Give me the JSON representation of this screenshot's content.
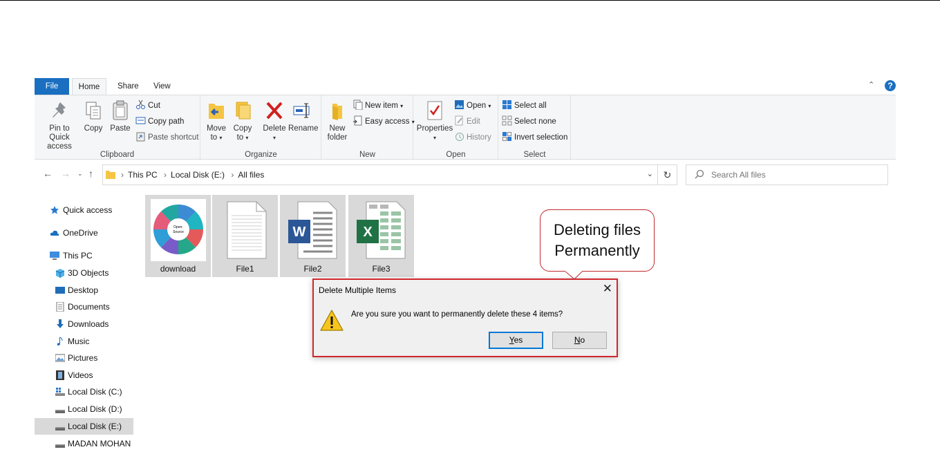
{
  "ribbon": {
    "tabs": {
      "file": "File",
      "home": "Home",
      "share": "Share",
      "view": "View"
    },
    "clipboard": {
      "label": "Clipboard",
      "pin_line1": "Pin to Quick",
      "pin_line2": "access",
      "copy": "Copy",
      "paste": "Paste",
      "cut": "Cut",
      "copy_path": "Copy path",
      "paste_shortcut": "Paste shortcut"
    },
    "organize": {
      "label": "Organize",
      "move_line1": "Move",
      "move_line2": "to",
      "copy_line1": "Copy",
      "copy_line2": "to",
      "delete": "Delete",
      "rename": "Rename"
    },
    "new": {
      "label": "New",
      "folder_line1": "New",
      "folder_line2": "folder",
      "new_item": "New item",
      "easy_access": "Easy access"
    },
    "open": {
      "label": "Open",
      "properties": "Properties",
      "open": "Open",
      "edit": "Edit",
      "history": "History"
    },
    "select": {
      "label": "Select",
      "select_all": "Select all",
      "select_none": "Select none",
      "invert": "Invert selection"
    }
  },
  "address": {
    "crumbs": [
      "This PC",
      "Local Disk (E:)",
      "All files"
    ]
  },
  "search": {
    "placeholder": "Search All files"
  },
  "nav": {
    "items": [
      {
        "label": "Quick access"
      },
      {
        "label": "OneDrive"
      },
      {
        "label": "This PC"
      },
      {
        "label": "3D Objects"
      },
      {
        "label": "Desktop"
      },
      {
        "label": "Documents"
      },
      {
        "label": "Downloads"
      },
      {
        "label": "Music"
      },
      {
        "label": "Pictures"
      },
      {
        "label": "Videos"
      },
      {
        "label": "Local Disk (C:)"
      },
      {
        "label": "Local Disk (D:)"
      },
      {
        "label": "Local Disk (E:)"
      },
      {
        "label": "MADAN MOHAN (F"
      }
    ]
  },
  "files": [
    {
      "name": "download",
      "type": "image"
    },
    {
      "name": "File1",
      "type": "text"
    },
    {
      "name": "File2",
      "type": "word"
    },
    {
      "name": "File3",
      "type": "excel"
    }
  ],
  "thumbnail": {
    "center_line1": "Open-",
    "center_line2": "Source"
  },
  "word_letter": "W",
  "excel_letter": "X",
  "callout": {
    "line1": "Deleting files",
    "line2": "Permanently"
  },
  "dialog": {
    "title": "Delete Multiple Items",
    "message": "Are you sure you want to permanently delete these 4 items?",
    "yes_accel": "Y",
    "yes_rest": "es",
    "no_accel": "N",
    "no_rest": "o"
  },
  "colors": {
    "accent": "#1a6fc1",
    "dialog_border": "#d0262d",
    "callout_border": "#c0272d",
    "selection": "#d9d9d9"
  }
}
